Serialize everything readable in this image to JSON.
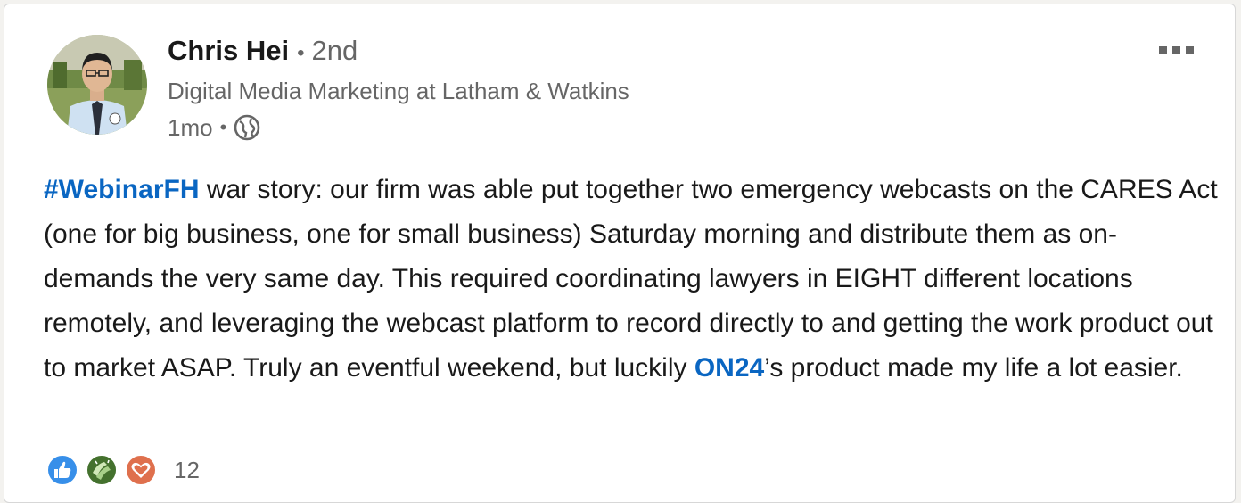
{
  "post": {
    "author": {
      "name": "Chris Hei",
      "separator": "•",
      "degree": "2nd",
      "headline": "Digital Media Marketing at Latham & Watkins"
    },
    "meta": {
      "time": "1mo",
      "separator": "•",
      "visibility_icon": "globe-icon"
    },
    "more_icon": "more-options-icon",
    "body": {
      "hashtag": "#WebinarFH",
      "text_part_1": " war story: our firm was able put together two emergency webcasts on the CARES Act (one for big business, one for small business) Saturday morning and distribute them as on-demands the very same day. This required coordinating lawyers in EIGHT different locations remotely, and leveraging the webcast platform to record directly to and getting the work product out to market ASAP. Truly an eventful weekend, but luckily ",
      "mention": "ON24",
      "text_part_2": "’s product made my life a lot easier."
    },
    "reactions": {
      "icons": [
        "like-icon",
        "celebrate-icon",
        "love-icon"
      ],
      "count": "12"
    },
    "colors": {
      "link": "#0a66c2",
      "like": "#378fe9",
      "celebrate": "#44712e",
      "love": "#df704d"
    }
  }
}
